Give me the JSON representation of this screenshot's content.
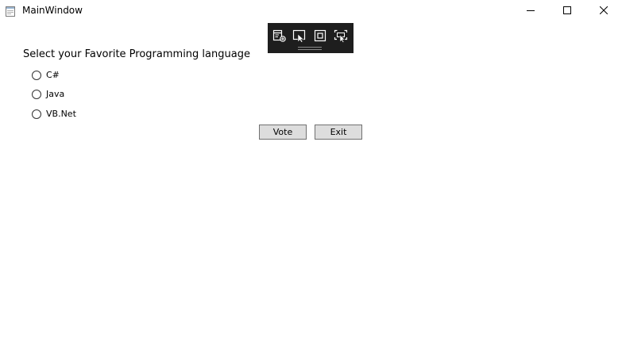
{
  "window": {
    "title": "MainWindow",
    "icons": {
      "app": "app-window-icon",
      "minimize": "minimize-icon",
      "maximize": "maximize-icon",
      "close": "close-icon"
    }
  },
  "dev_toolbar": {
    "tools": [
      {
        "name": "go-to-live-visual-tree-icon"
      },
      {
        "name": "select-element-icon"
      },
      {
        "name": "display-layout-adorners-icon"
      },
      {
        "name": "track-focused-element-icon"
      }
    ]
  },
  "form": {
    "question": "Select your Favorite Programming language",
    "options": [
      {
        "label": "C#",
        "selected": false
      },
      {
        "label": "Java",
        "selected": false
      },
      {
        "label": "VB.Net",
        "selected": false
      }
    ],
    "vote_label": "Vote",
    "exit_label": "Exit"
  },
  "colors": {
    "toolbar_bg": "#1e1e1e",
    "button_bg": "#dddddd",
    "button_border": "#707070"
  }
}
